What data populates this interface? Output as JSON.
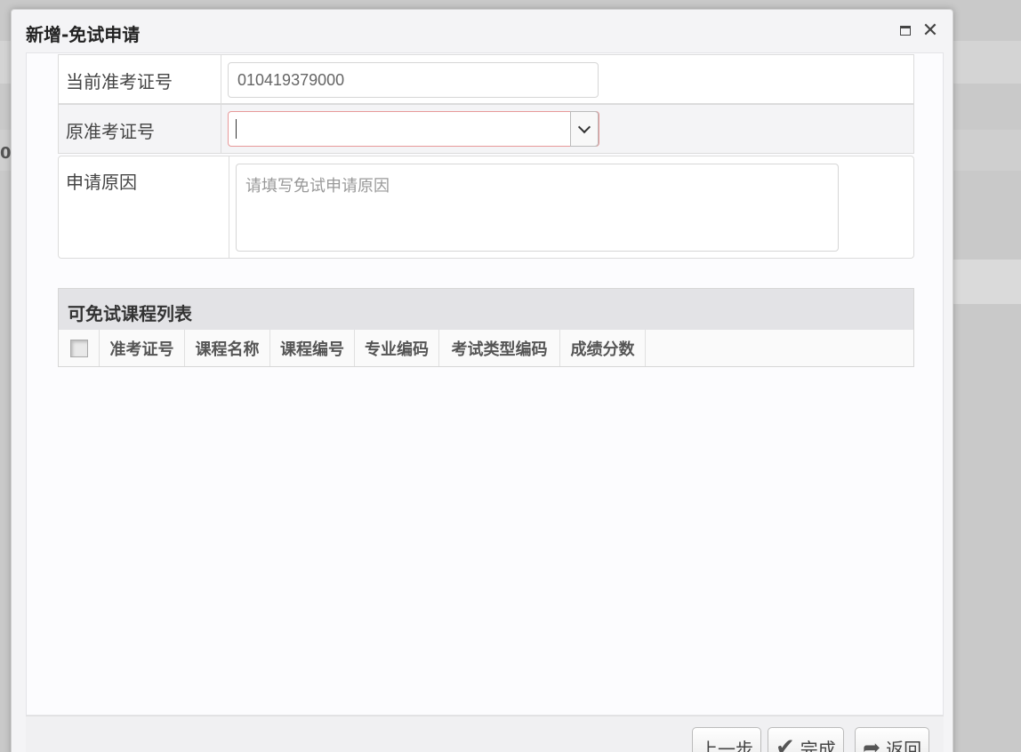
{
  "dialog": {
    "title": "新增-免试申请",
    "maximize_icon": "maximize-icon",
    "close_label": "✕"
  },
  "background": {
    "fragment_text": "0"
  },
  "form": {
    "current_ticket": {
      "label": "当前准考证号",
      "value": "010419379000"
    },
    "original_ticket": {
      "label": "原准考证号",
      "value": ""
    },
    "reason": {
      "label": "申请原因",
      "placeholder": "请填写免试申请原因"
    }
  },
  "grid": {
    "title": "可免试课程列表",
    "columns": [
      "准考证号",
      "课程名称",
      "课程编号",
      "专业编码",
      "考试类型编码",
      "成绩分数"
    ]
  },
  "footer": {
    "prev_label": "上一步",
    "finish_label": "完成",
    "back_label": "返回"
  }
}
